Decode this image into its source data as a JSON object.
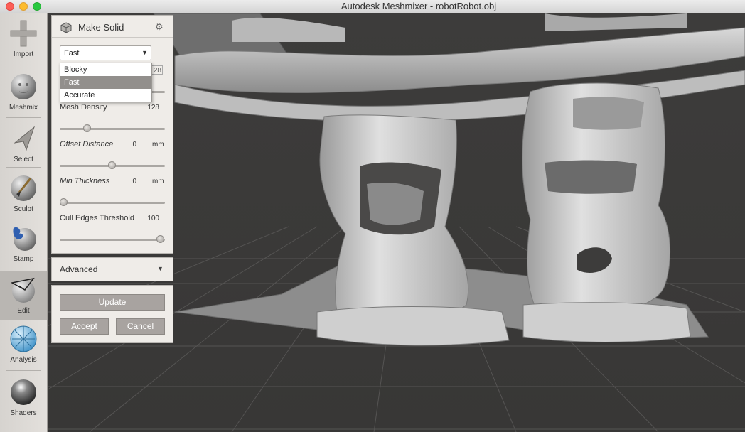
{
  "window": {
    "title": "Autodesk Meshmixer - robotRobot.obj"
  },
  "toolbar": {
    "items": [
      {
        "label": "Import"
      },
      {
        "label": "Meshmix"
      },
      {
        "label": "Select"
      },
      {
        "label": "Sculpt"
      },
      {
        "label": "Stamp"
      },
      {
        "label": "Edit",
        "active": true
      },
      {
        "label": "Analysis"
      },
      {
        "label": "Shaders"
      }
    ]
  },
  "panel": {
    "title": "Make Solid",
    "solid_type": {
      "selected": "Fast",
      "options": [
        "Blocky",
        "Fast",
        "Accurate"
      ],
      "highlighted": "Fast"
    },
    "partial_value": "28",
    "mesh_density": {
      "label": "Mesh Density",
      "value": "128",
      "fraction": 0.25
    },
    "offset_distance": {
      "label": "Offset Distance",
      "value": "0",
      "unit": "mm",
      "fraction": 0.5
    },
    "min_thickness": {
      "label": "Min Thickness",
      "value": "0",
      "unit": "mm",
      "fraction": 0.0
    },
    "cull_edges": {
      "label": "Cull Edges Threshold",
      "value": "100",
      "fraction": 1.0
    },
    "advanced_label": "Advanced",
    "update_label": "Update",
    "accept_label": "Accept",
    "cancel_label": "Cancel"
  },
  "colors": {
    "viewport_bg": "#3a3938",
    "mesh": "#c8c8c8",
    "panel_bg": "#efece8",
    "button": "#a8a3a0"
  },
  "icons": [
    "plus-icon",
    "face-sphere-icon",
    "cursor-arrow-icon",
    "brush-icon",
    "stamp-icon",
    "edit-mesh-icon",
    "analysis-sphere-icon",
    "shader-sphere-icon",
    "cube-icon",
    "gear-icon",
    "chevron-down-icon"
  ]
}
